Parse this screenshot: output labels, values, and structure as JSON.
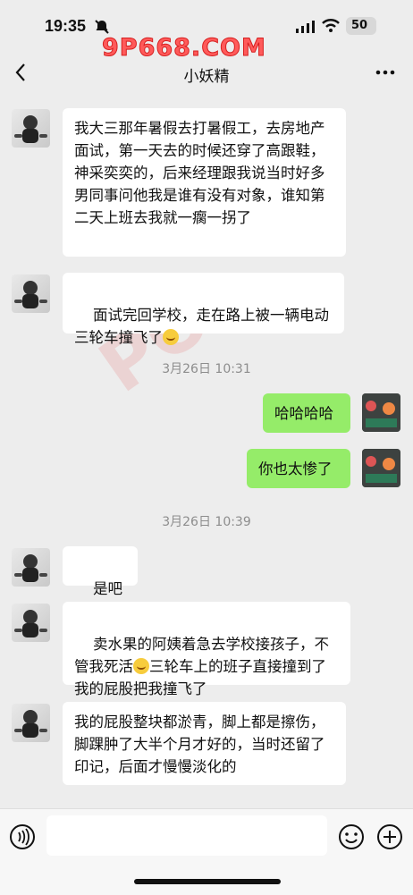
{
  "status": {
    "time": "19:35",
    "battery": "50"
  },
  "watermark": {
    "top": "9P668.COM"
  },
  "header": {
    "title": "小妖精"
  },
  "messages": [
    {
      "text": "我大三那年暑假去打暑假工，去房地产面试，第一天去的时候还穿了高跟鞋，神采奕奕的，后来经理跟我说当时好多男同事问他我是谁有没有对象，谁知第二天上班去我就一瘸一拐了"
    },
    {
      "text": "面试完回学校，走在路上被一辆电动三轮车撞飞了"
    },
    {
      "timestamp": "3月26日 10:31"
    },
    {
      "text": "哈哈哈哈"
    },
    {
      "text": "你也太惨了"
    },
    {
      "timestamp": "3月26日 10:39"
    },
    {
      "text": "是吧"
    },
    {
      "text": "卖水果的阿姨着急去学校接孩子，不管我死活"
    },
    {
      "text": "三轮车上的班子直接撞到了我的屁股把我撞飞了"
    },
    {
      "text": "我的屁股整块都淤青，脚上都是擦伤，脚踝肿了大半个月才好的，当时还留了印记，后面才慢慢淡化的"
    }
  ],
  "icons": {
    "back": "chevron-left-icon",
    "more": "more-icon",
    "voice": "voice-icon",
    "emoji": "emoji-icon",
    "plus": "plus-icon"
  },
  "colors": {
    "background": "#ededed",
    "mine_bubble": "#95ec69",
    "bubble": "#ffffff",
    "watermark": "#ff5a5a"
  }
}
